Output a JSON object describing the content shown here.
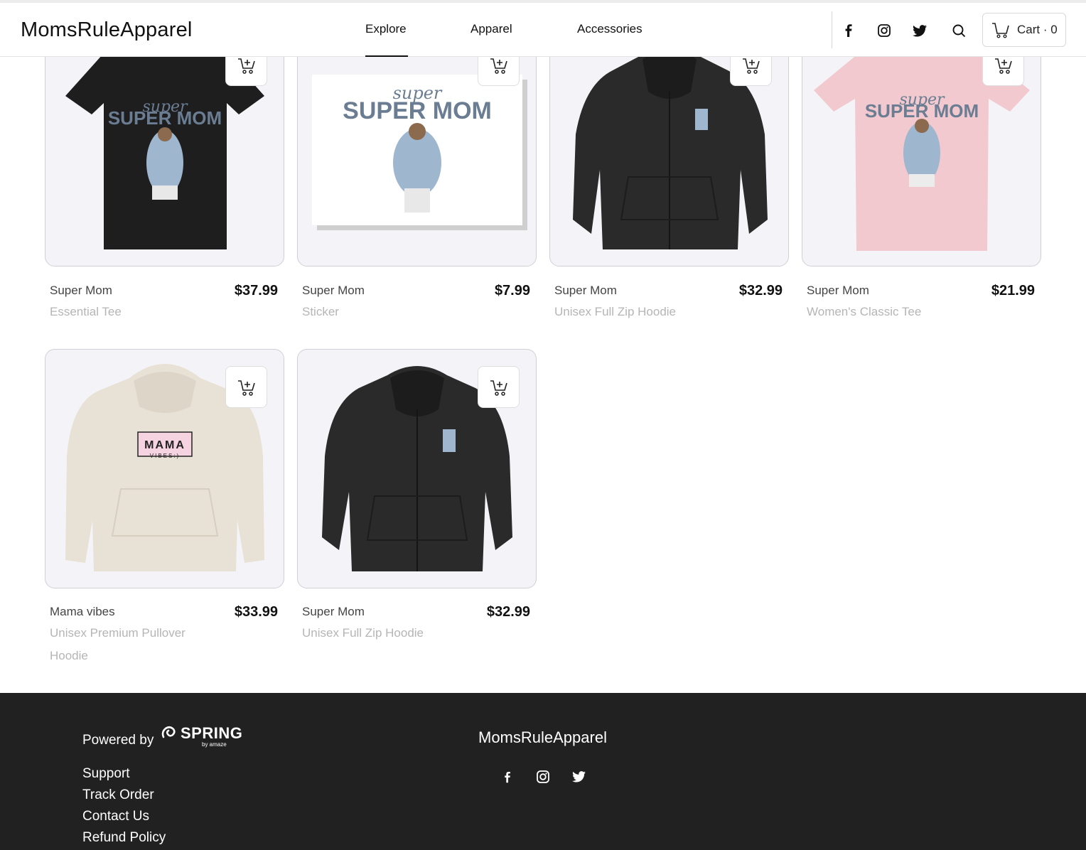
{
  "header": {
    "logo": "MomsRuleApparel",
    "nav": [
      {
        "label": "Explore",
        "active": true
      },
      {
        "label": "Apparel",
        "active": false
      },
      {
        "label": "Accessories",
        "active": false
      }
    ],
    "icons": [
      "facebook-icon",
      "instagram-icon",
      "twitter-icon",
      "search-icon"
    ],
    "cart_label": "Cart · 0"
  },
  "products": [
    {
      "name": "Super Mom",
      "type": "Essential Tee",
      "price": "$37.99",
      "art": "SUPER MOM"
    },
    {
      "name": "Super Mom",
      "type": "Sticker",
      "price": "$7.99",
      "art": "SUPER MOM"
    },
    {
      "name": "Super Mom",
      "type": "Unisex Full Zip Hoodie",
      "price": "$32.99",
      "art": ""
    },
    {
      "name": "Super Mom",
      "type": "Women's Classic Tee",
      "price": "$21.99",
      "art": "SUPER MOM"
    },
    {
      "name": "Mama vibes",
      "type_line1": "Unisex Premium Pullover",
      "type_line2": "Hoodie",
      "price": "$33.99",
      "art": "MAMA",
      "art_sub": "VIBES:)"
    },
    {
      "name": "Super Mom",
      "type": "Unisex Full Zip Hoodie",
      "price": "$32.99",
      "art": ""
    }
  ],
  "footer": {
    "powered_by": "Powered by",
    "spring_logo": "SPRING",
    "spring_by": "by amaze",
    "links": [
      "Support",
      "Track Order",
      "Contact Us",
      "Refund Policy"
    ],
    "brand": "MomsRuleApparel",
    "icons": [
      "facebook-icon",
      "instagram-icon",
      "twitter-icon"
    ]
  },
  "colors": {
    "card_bg": "#f4f4f8",
    "footer_bg": "#212121",
    "tee_black": "#1e1e1e",
    "tee_pink": "#f2c9cf",
    "hoodie_cream": "#e8e2d6",
    "hoodie_black": "#2a2a2a",
    "art_slate": "#6a7d92"
  }
}
